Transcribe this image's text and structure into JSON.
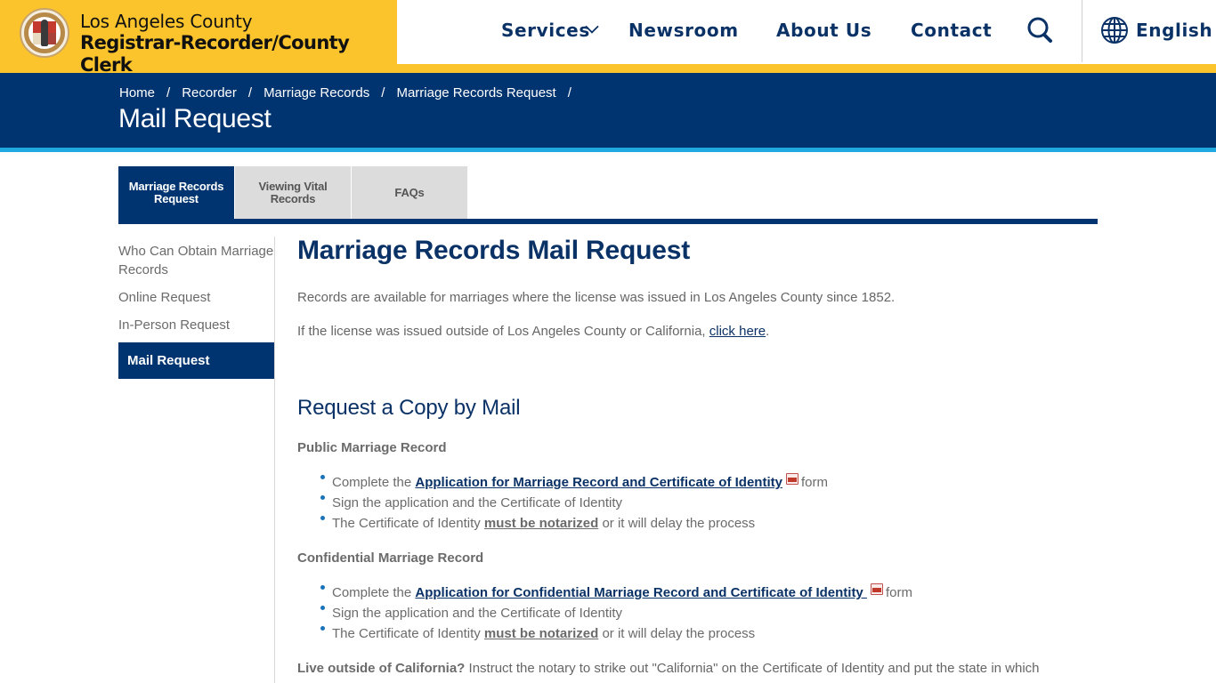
{
  "header": {
    "org_line1": "Los Angeles County",
    "org_line2": "Registrar-Recorder/County Clerk",
    "nav": [
      {
        "label": "Services",
        "has_dropdown": true
      },
      {
        "label": "Newsroom"
      },
      {
        "label": "About Us"
      },
      {
        "label": "Contact"
      }
    ],
    "search_icon": "search-icon",
    "language": {
      "icon": "globe-icon",
      "label": "English"
    }
  },
  "colors": {
    "brand_yellow": "#fbc42c",
    "brand_navy": "#003470",
    "accent_cyan": "#1fa9df",
    "heading_blue": "#0a3266",
    "tab_inactive": "#dcdcdc"
  },
  "banner": {
    "breadcrumb": [
      "Home",
      "Recorder",
      "Marriage Records",
      "Marriage Records Request"
    ],
    "separator": "/",
    "title": "Mail Request"
  },
  "tabs": [
    {
      "label": "Marriage Records Request",
      "active": true
    },
    {
      "label": "Viewing Vital Records",
      "active": false
    },
    {
      "label": "FAQs",
      "active": false
    }
  ],
  "sidebar": {
    "items": [
      {
        "label": "Who Can Obtain Marriage Records",
        "active": false
      },
      {
        "label": "Online Request",
        "active": false
      },
      {
        "label": "In-Person Request",
        "active": false
      },
      {
        "label": "Mail Request",
        "active": true
      }
    ]
  },
  "main": {
    "title": "Marriage Records Mail Request",
    "intro": "Records are available for marriages where the license was issued in Los Angeles County since 1852.",
    "outside_text": "If the license was issued outside of Los Angeles County or California, ",
    "outside_link": "click here",
    "outside_end": ".",
    "section_title": "Request a Copy by Mail",
    "public": {
      "heading": "Public Marriage Record",
      "step1_prefix": "Complete the ",
      "step1_link": "Application for Marriage Record and Certificate of Identity",
      "step1_suffix": "form",
      "step2": "Sign the application and the Certificate of Identity",
      "step3_prefix": "The Certificate of Identity ",
      "step3_link": "must be notarized",
      "step3_suffix": " or it will delay the process"
    },
    "confidential": {
      "heading": "Confidential Marriage Record",
      "step1_prefix": "Complete the ",
      "step1_link": "Application for Confidential Marriage Record and Certificate of Identity ",
      "step1_suffix": "form",
      "step2": "Sign the application and the Certificate of Identity",
      "step3_prefix": "The Certificate of Identity ",
      "step3_link": "must be notarized",
      "step3_suffix": " or it will delay the process"
    },
    "outside_ca_bold": "Live outside of California?",
    "outside_ca_text": " Instruct the notary to strike out \"California\" on the Certificate of Identity and put the state in which"
  }
}
